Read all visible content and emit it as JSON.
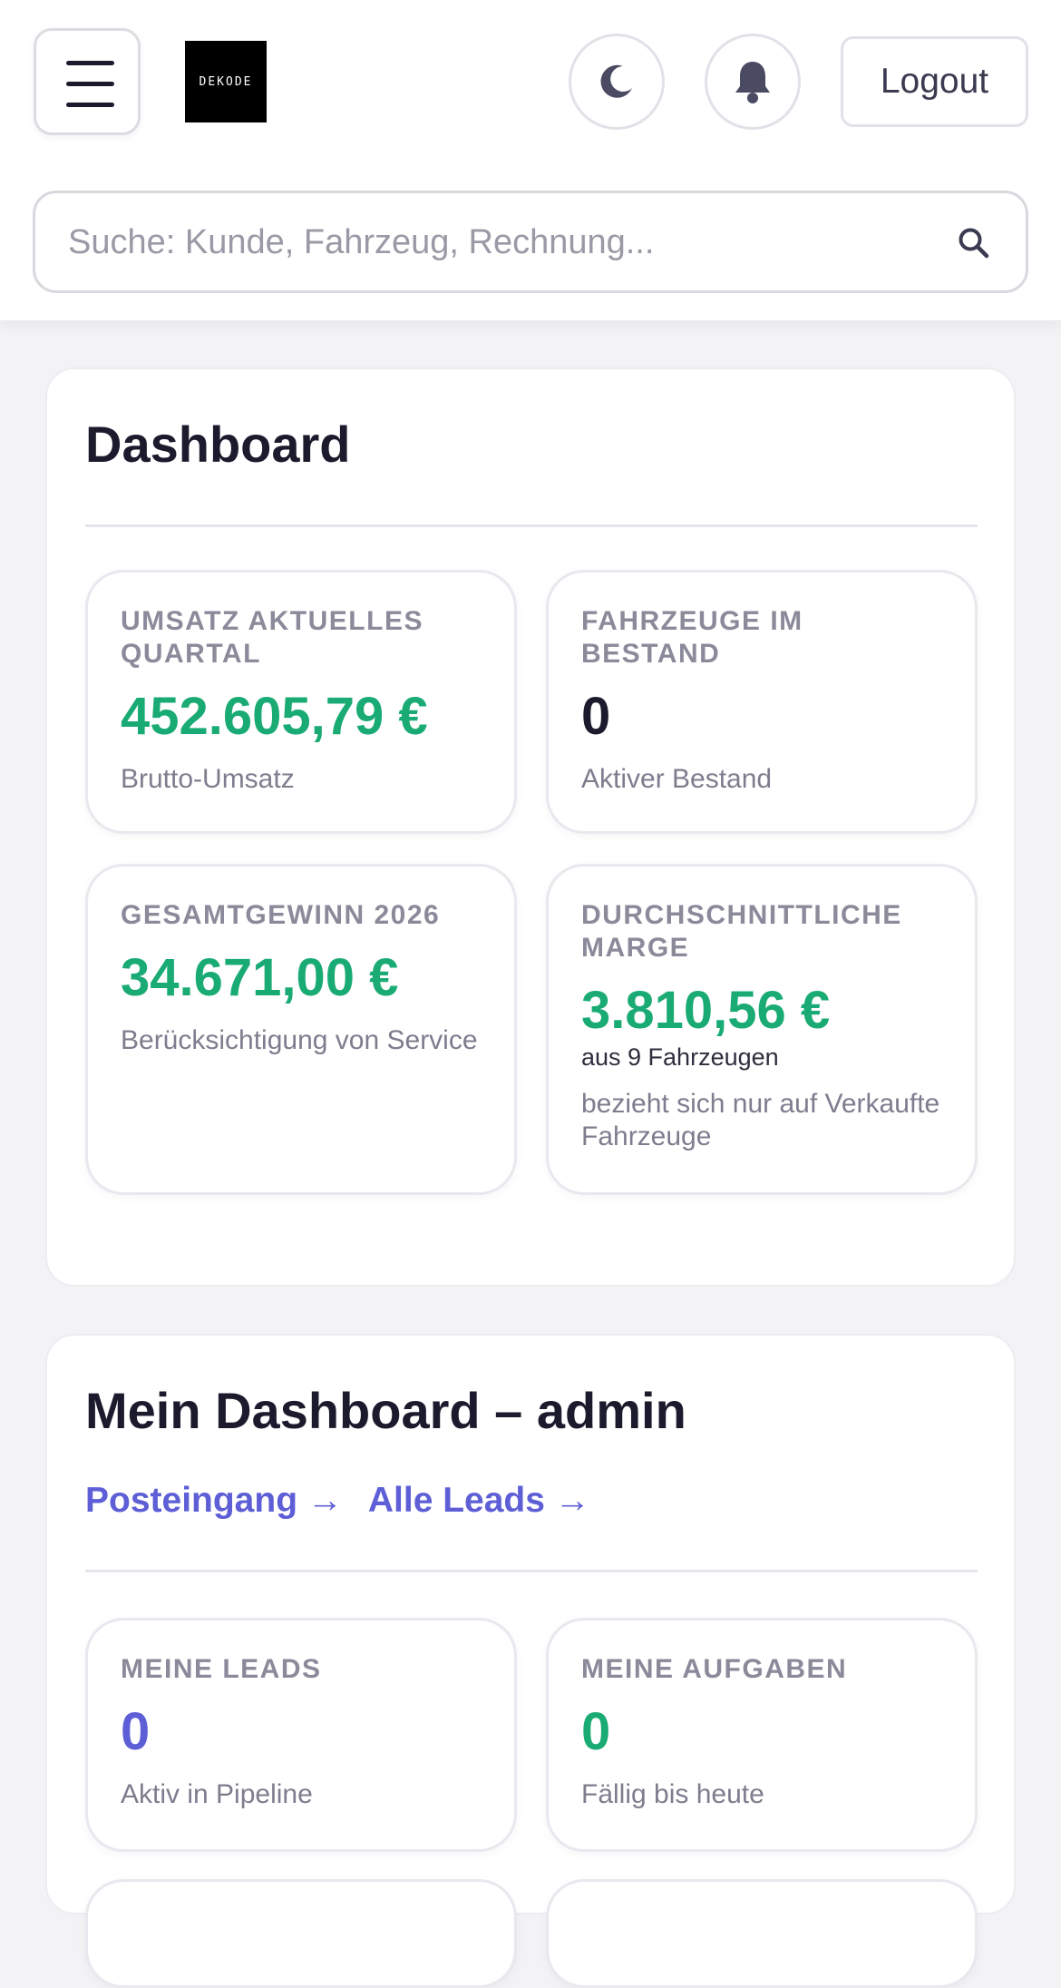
{
  "header": {
    "logo_text": "DEKODE",
    "logout_label": "Logout",
    "search_placeholder": "Suche: Kunde, Fahrzeug, Rechnung..."
  },
  "dashboard": {
    "title": "Dashboard",
    "stats": [
      {
        "label": "UMSATZ AKTUELLES QUARTAL",
        "value": "452.605,79 €",
        "desc": "Brutto-Umsatz",
        "color": "#1aab74"
      },
      {
        "label": "FAHRZEUGE IM BESTAND",
        "value": "0",
        "desc": "Aktiver Bestand",
        "color": "#1c1b2e"
      },
      {
        "label": "GESAMTGEWINN 2026",
        "value": "34.671,00 €",
        "desc": "Berücksichtigung von Service",
        "color": "#1aab74"
      },
      {
        "label": "DURCHSCHNITTLICHE MARGE",
        "value": "3.810,56 €",
        "note": "aus 9 Fahrzeugen",
        "desc": "bezieht sich nur auf Verkaufte Fahrzeuge",
        "color": "#1aab74"
      }
    ]
  },
  "my_dashboard": {
    "title": "Mein Dashboard – admin",
    "links": [
      "Posteingang →",
      "Alle Leads →"
    ],
    "stats": [
      {
        "label": "MEINE LEADS",
        "value": "0",
        "desc": "Aktiv in Pipeline",
        "color": "#5e5fd6"
      },
      {
        "label": "MEINE AUFGABEN",
        "value": "0",
        "desc": "Fällig bis heute",
        "color": "#1aab74"
      }
    ]
  },
  "icons": {
    "menu": "hamburger-menu-icon",
    "theme": "moon-icon",
    "notifications": "bell-icon",
    "search": "search-icon"
  }
}
